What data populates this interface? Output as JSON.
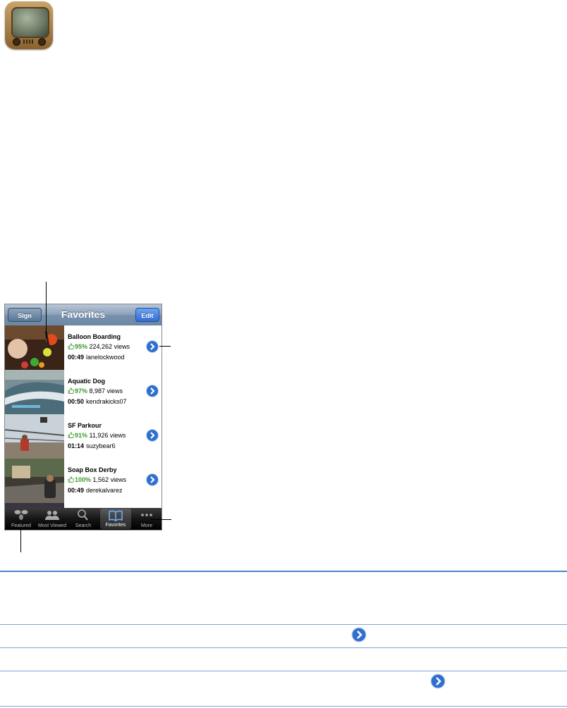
{
  "app": {
    "icon": "youtube-tv-icon"
  },
  "navbar": {
    "title": "Favorites",
    "left_button": "Sign Out",
    "right_button": "Edit"
  },
  "videos": [
    {
      "title": "Balloon Boarding",
      "rating": "95%",
      "views": "224,262 views",
      "duration": "00:49",
      "user": "lanelockwood"
    },
    {
      "title": "Aquatic Dog",
      "rating": "97%",
      "views": "8,987 views",
      "duration": "00:50",
      "user": "kendrakicks07"
    },
    {
      "title": "SF Parkour",
      "rating": "91%",
      "views": "11,926 views",
      "duration": "01:14",
      "user": "suzybear6"
    },
    {
      "title": "Soap Box Derby",
      "rating": "100%",
      "views": "1,562 views",
      "duration": "00:49",
      "user": "derekalvarez"
    }
  ],
  "tabs": [
    {
      "label": "Featured",
      "icon": "featured-icon",
      "active": false
    },
    {
      "label": "Most Viewed",
      "icon": "most-viewed-icon",
      "active": false
    },
    {
      "label": "Search",
      "icon": "search-icon",
      "active": false
    },
    {
      "label": "Favorites",
      "icon": "favorites-book-icon",
      "active": true
    },
    {
      "label": "More",
      "icon": "more-icon",
      "active": false
    }
  ],
  "colors": {
    "accent": "#4a86c5",
    "rating_green": "#3a9a2a",
    "disclosure_blue": "#2f6fd0"
  }
}
